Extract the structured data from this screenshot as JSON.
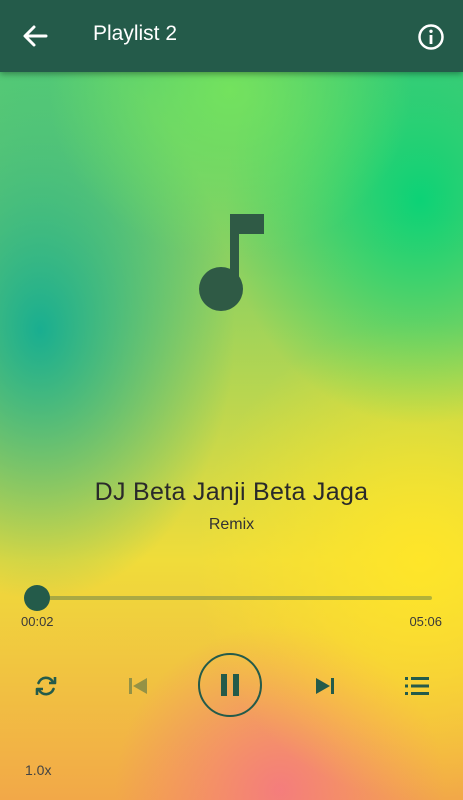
{
  "header": {
    "title": "Playlist 2",
    "back_icon": "arrow-back-icon",
    "info_icon": "info-icon",
    "bar_color": "#245b4a"
  },
  "artwork": {
    "icon": "music-note-icon",
    "icon_color": "#2f5a45"
  },
  "track": {
    "title": "DJ Beta Janji Beta Jaga",
    "artist": "Remix"
  },
  "progress": {
    "current_time": "00:02",
    "total_time": "05:06",
    "fraction": 0.007
  },
  "controls": {
    "repeat_icon": "repeat-icon",
    "previous_icon": "skip-previous-icon",
    "play_pause_icon": "pause-icon",
    "next_icon": "skip-next-icon",
    "queue_icon": "queue-list-icon",
    "accent_color": "#245b4a"
  },
  "playback_speed": "1.0x"
}
